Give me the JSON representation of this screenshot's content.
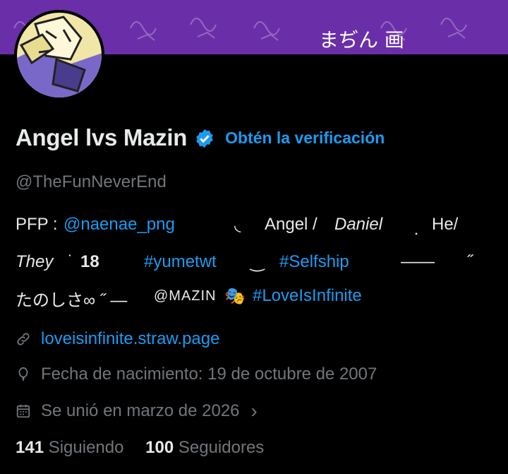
{
  "banner": {
    "kanji_text": "まぢん 画",
    "accent": "#6a2fa8"
  },
  "profile": {
    "display_name": "Angel lvs Mazin",
    "get_verified_label": "Obtén la verificación",
    "handle": "@TheFunNeverEnd"
  },
  "bio": {
    "pfp_label": "PFP :",
    "pfp_link": "@naenae_png",
    "deco1": "◟",
    "angel": "Angel /",
    "daniel": "Daniel",
    "deco2": "﹒",
    "he": "He/",
    "they": "They",
    "deco3": "˙",
    "age": "18",
    "tag_yume": "#yumetwt",
    "deco4": "‿",
    "tag_selfship": "#Selfship",
    "dash": "——",
    "quote_open": "˝",
    "line3_text": "たのしさ∞ ˝ — ",
    "mazin": "@MAZIN",
    "masks": "🎭",
    "tag_love": "#LoveIsInfinite"
  },
  "meta": {
    "website": "loveisinfinite.straw.page",
    "birthday": "Fecha de nacimiento: 19 de octubre de 2007",
    "joined": "Se unió en marzo de 2026",
    "joined_chevron": "›"
  },
  "stats": {
    "following_count": "141",
    "following_label": "Siguiendo",
    "followers_count": "100",
    "followers_label": "Seguidores"
  },
  "colors": {
    "link": "#1d9bf0",
    "muted": "#71767b",
    "text": "#e7e9ea",
    "background": "#000000"
  }
}
